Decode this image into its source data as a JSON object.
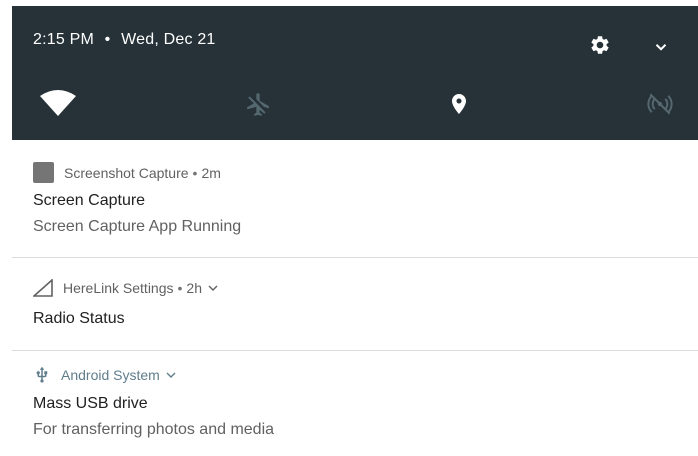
{
  "status_bar": {
    "time": "2:15 PM",
    "separator": "•",
    "date": "Wed, Dec 21"
  },
  "quick_settings": {
    "background": "#263238",
    "tiles": [
      {
        "icon": "wifi-icon",
        "state": "on"
      },
      {
        "icon": "airplane-mode-icon",
        "state": "off"
      },
      {
        "icon": "location-icon",
        "state": "on"
      },
      {
        "icon": "hotspot-icon",
        "state": "off"
      }
    ]
  },
  "notifications": [
    {
      "app_name": "Screenshot Capture",
      "separator": "•",
      "time": "2m",
      "title": "Screen Capture",
      "text": "Screen Capture App Running"
    },
    {
      "app_name": "HereLink Settings",
      "separator": "•",
      "time": "2h",
      "title": "Radio Status"
    },
    {
      "app_name": "Android System",
      "title": "Mass USB drive",
      "text": "For transferring photos and media",
      "accent": "#607D8B"
    }
  ]
}
